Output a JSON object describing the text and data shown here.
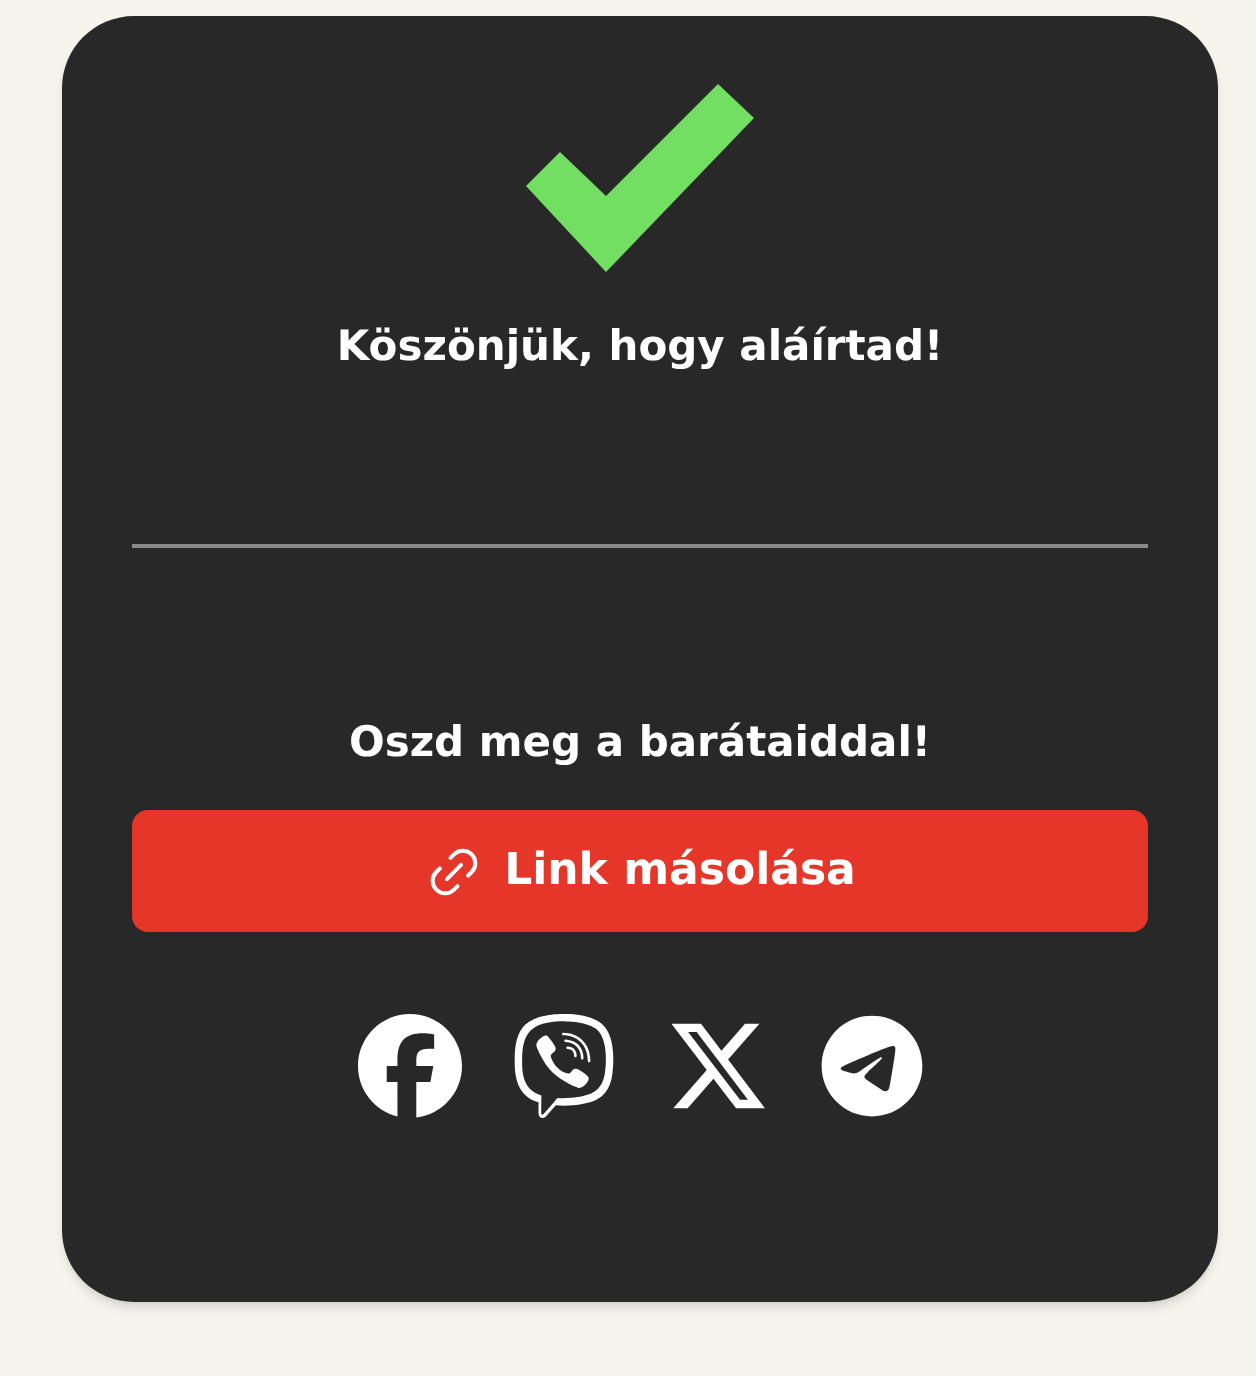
{
  "title": "Köszönjük, hogy aláírtad!",
  "share_heading": "Oszd meg a barátaiddal!",
  "copy_button": {
    "label": "Link másolása"
  },
  "social": [
    {
      "kind": "facebook"
    },
    {
      "kind": "viber"
    },
    {
      "kind": "x"
    },
    {
      "kind": "telegram"
    }
  ]
}
